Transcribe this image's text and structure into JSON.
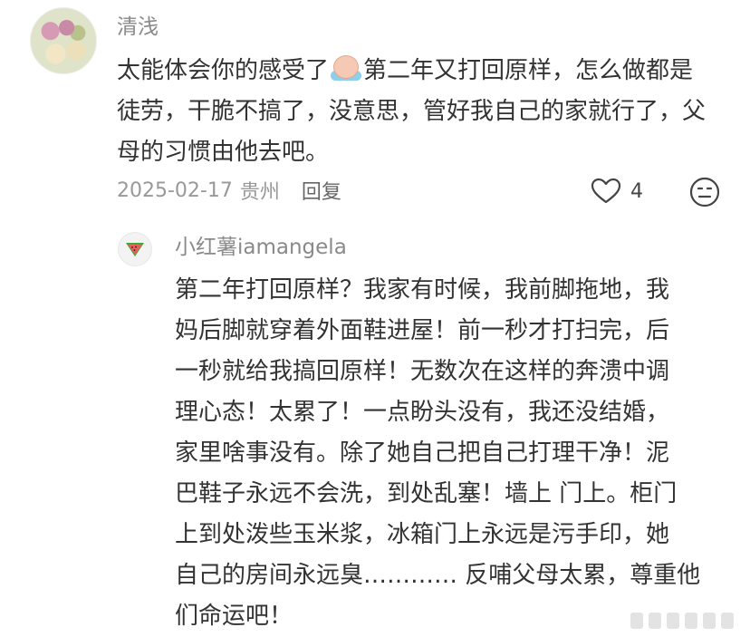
{
  "comment": {
    "username": "清浅",
    "text_before_emoji": "太能体会你的感受了",
    "emoji_icon": "crying-face-emoji",
    "text_after_emoji": "第二年又打回原样，怎么做都是徒劳，干脆不搞了，没意思，管好我自己的家就行了，父母的习惯由他去吧。",
    "date": "2025-02-17",
    "location": "贵州",
    "reply_label": "回复",
    "like_count": "4"
  },
  "reply": {
    "username": "小红薯iamangela",
    "avatar_icon": "watermelon-icon",
    "lines": [
      "第二年打回原样？我家有时候，我前脚拖地，我",
      "妈后脚就穿着外面鞋进屋！前一秒才打扫完，后",
      "一秒就给我搞回原样！无数次在这样的奔溃中调",
      "理心态！太累了！一点盼头没有，我还没结婚，",
      "家里啥事没有。除了她自己把自己打理干净！泥",
      "巴鞋子永远不会洗，到处乱塞！墙上 门上。柜门",
      "上到处泼些玉米浆，冰箱门上永远是污手印，她",
      "自己的房间永远臭………… 反哺父母太累，尊重他",
      "们命运吧！"
    ]
  }
}
